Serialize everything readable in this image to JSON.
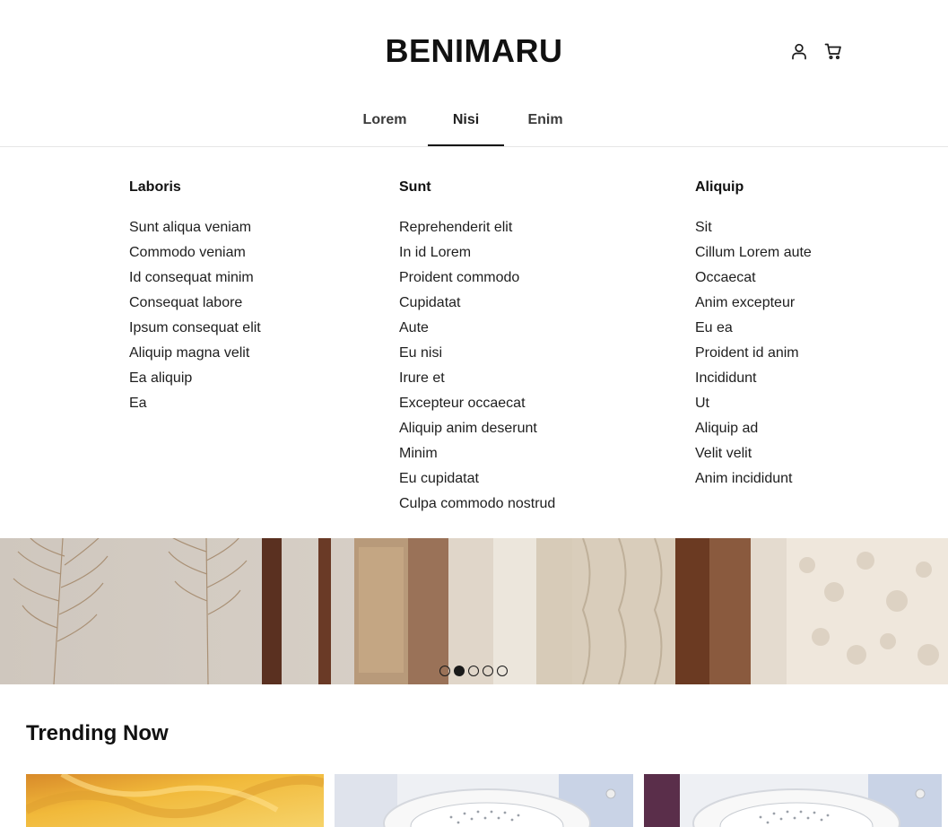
{
  "brand": {
    "name": "BENIMARU"
  },
  "header_icons": [
    "user-icon",
    "cart-icon"
  ],
  "nav": {
    "tabs": [
      {
        "label": "Lorem",
        "active": false
      },
      {
        "label": "Nisi",
        "active": true
      },
      {
        "label": "Enim",
        "active": false
      }
    ]
  },
  "mega_menu": {
    "columns": [
      {
        "title": "Laboris",
        "items": [
          "Sunt aliqua veniam",
          "Commodo veniam",
          "Id consequat minim",
          "Consequat labore",
          "Ipsum consequat elit",
          "Aliquip magna velit",
          "Ea aliquip",
          "Ea"
        ]
      },
      {
        "title": "Sunt",
        "items": [
          "Reprehenderit elit",
          "In id Lorem",
          "Proident commodo",
          "Cupidatat",
          "Aute",
          "Eu nisi",
          "Irure et",
          "Excepteur occaecat",
          "Aliquip anim deserunt",
          "Minim",
          "Eu cupidatat",
          "Culpa commodo nostrud"
        ]
      },
      {
        "title": "Aliquip",
        "items": [
          "Sit",
          "Cillum Lorem aute",
          "Occaecat",
          "Anim excepteur",
          "Eu ea",
          "Proident id anim",
          "Incididunt",
          "Ut",
          "Aliquip ad",
          "Velit velit",
          "Anim incididunt"
        ]
      }
    ]
  },
  "carousel": {
    "slide_count": 5,
    "active_index": 1
  },
  "trending": {
    "title": "Trending Now",
    "card_count": 3
  },
  "colors": {
    "accent": "#111111",
    "divider": "#e6e6e6"
  }
}
